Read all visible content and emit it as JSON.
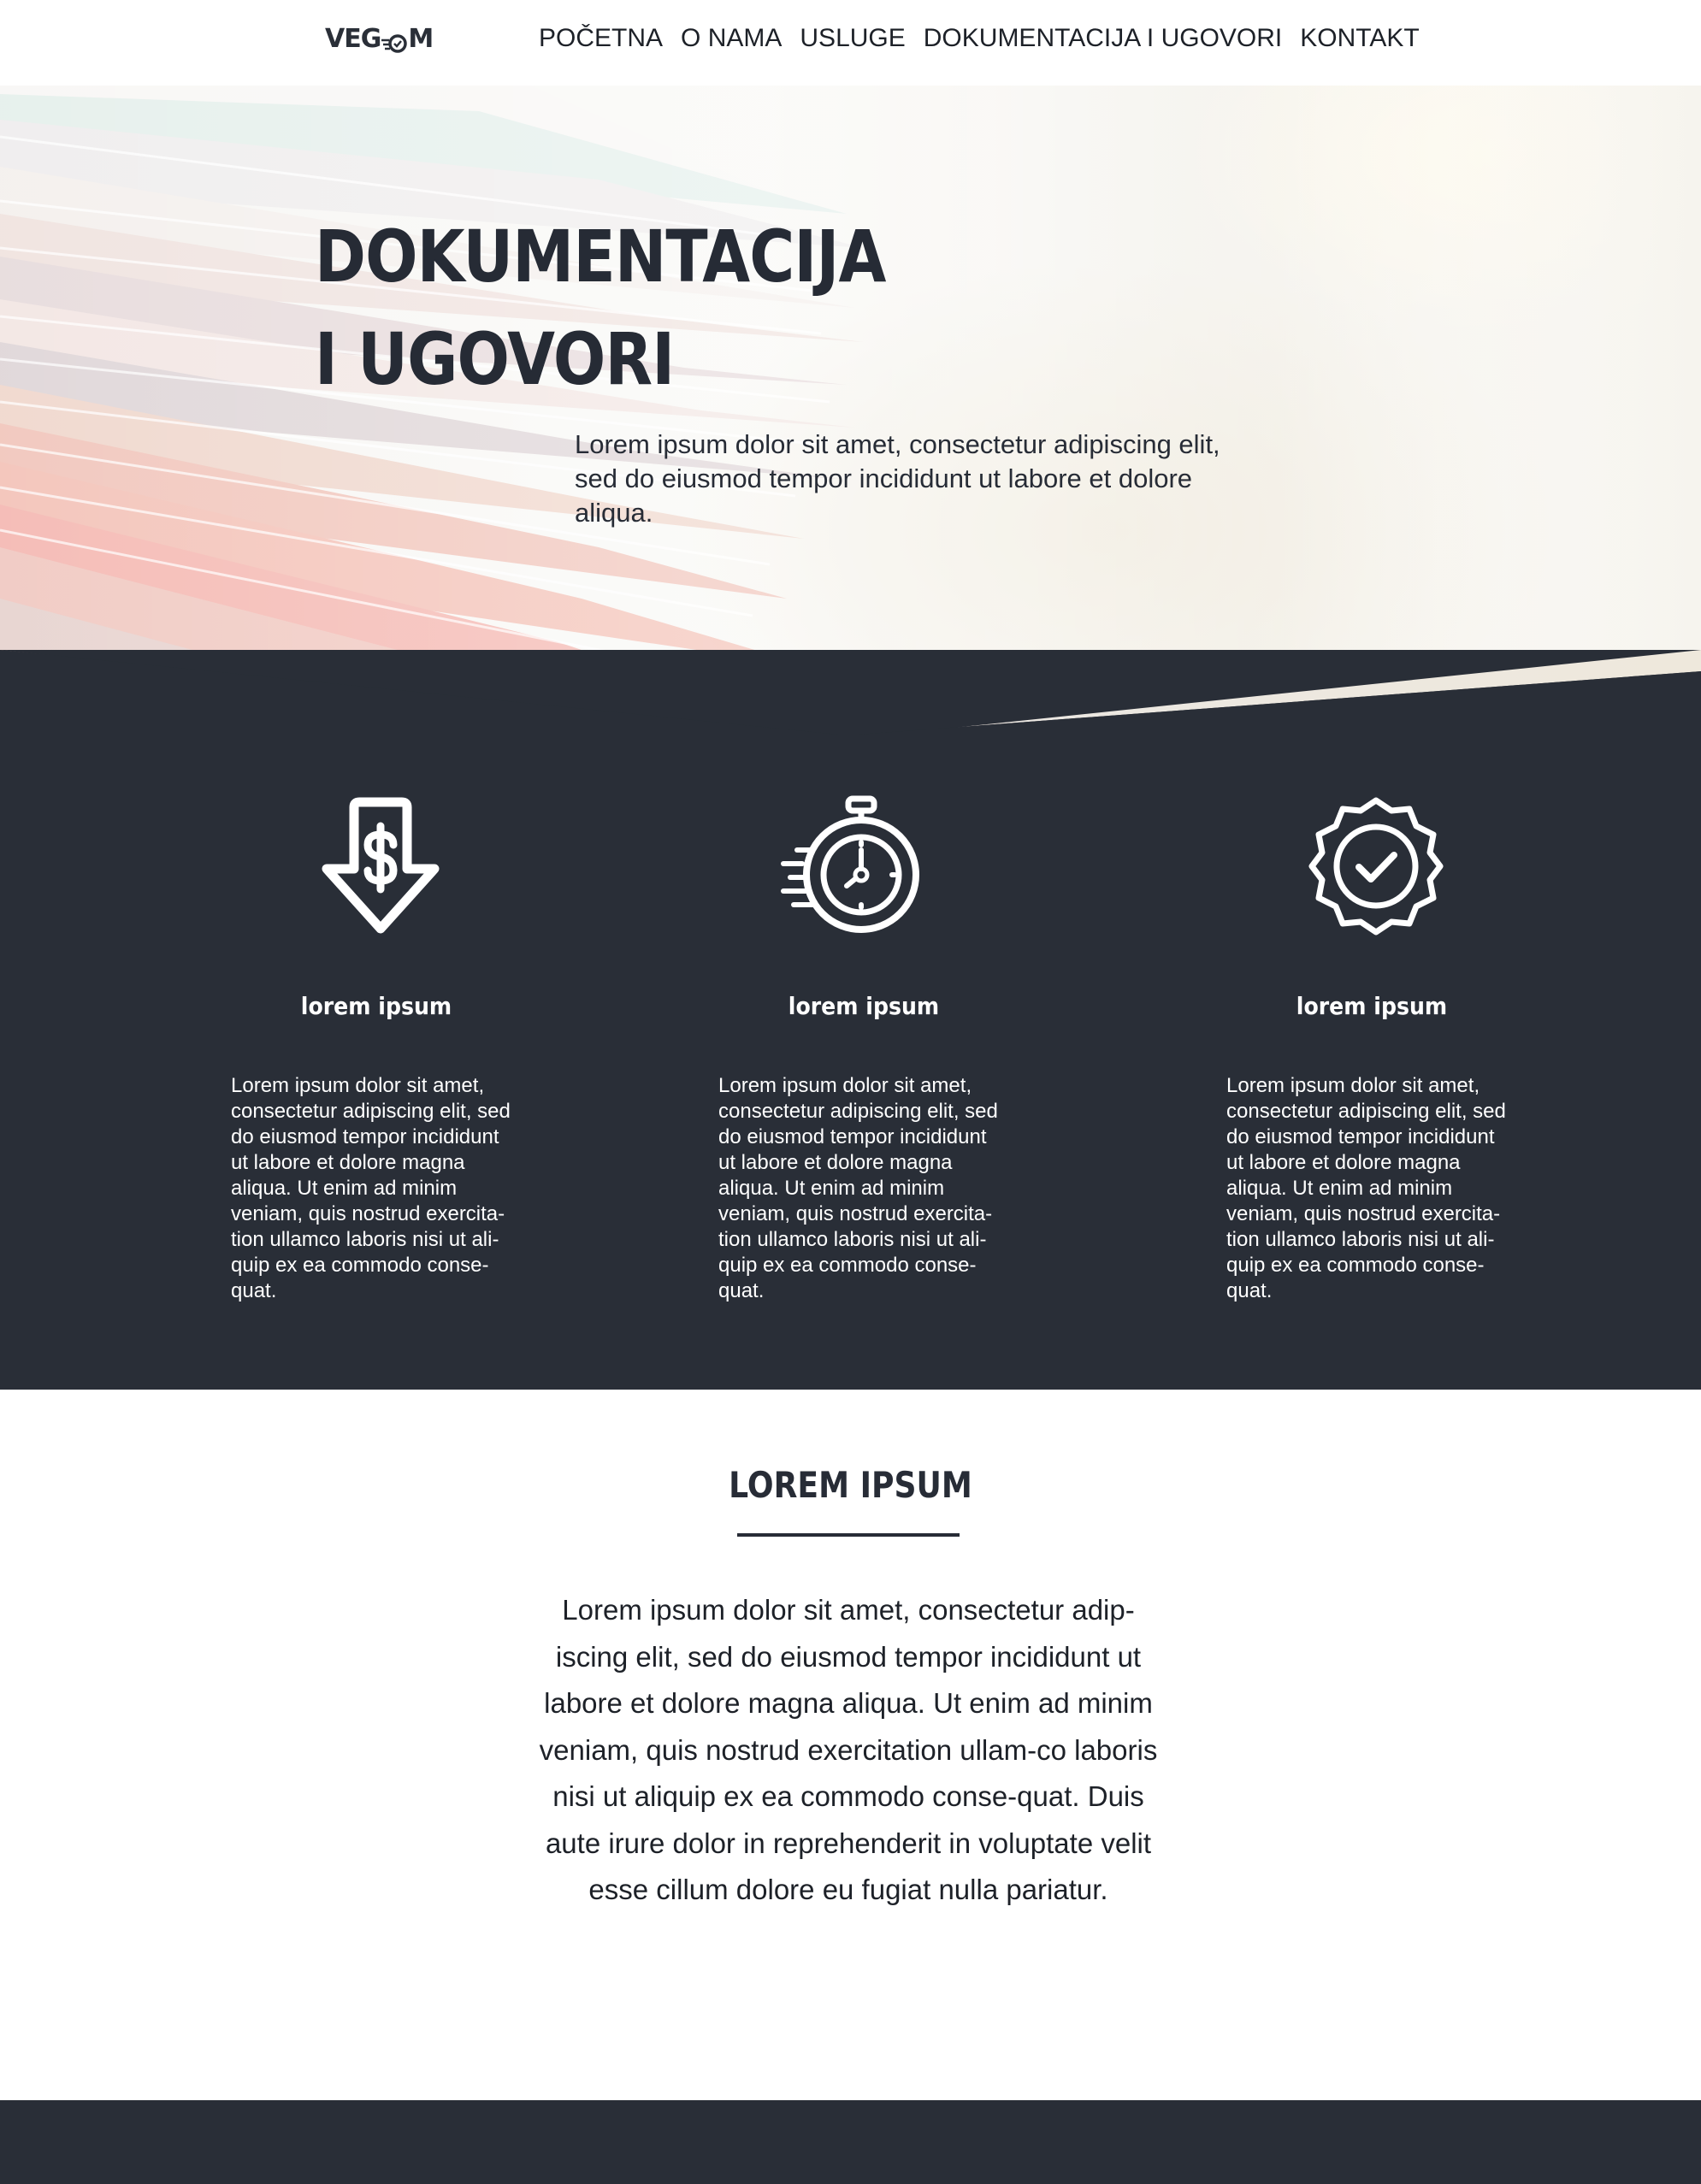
{
  "brand": {
    "logo_text_left": "VEG",
    "logo_text_right": "M"
  },
  "nav": {
    "items": [
      {
        "label": "POČETNA"
      },
      {
        "label": "O NAMA"
      },
      {
        "label": "USLUGE"
      },
      {
        "label": "DOKUMENTACIJA I UGOVORI"
      },
      {
        "label": "KONTAKT"
      }
    ]
  },
  "hero": {
    "title_line1": "DOKUMENTACIJA",
    "title_line2": "I UGOVORI",
    "text": "Lorem ipsum dolor sit amet, consectetur adipiscing elit, sed do eiusmod tempor incididunt ut labore et dolore aliqua."
  },
  "features": [
    {
      "icon": "dollar-down-arrow-icon",
      "title": "lorem ipsum",
      "text": "Lorem ipsum dolor sit amet, consectetur adipiscing elit, sed do eiusmod tempor incididunt ut labore et dolore magna aliqua. Ut enim ad minim veniam, quis nostrud exercita-tion ullamco laboris nisi ut ali-quip ex ea commodo conse-quat."
    },
    {
      "icon": "stopwatch-icon",
      "title": "lorem ipsum",
      "text": "Lorem ipsum dolor sit amet, consectetur adipiscing elit, sed do eiusmod tempor incididunt ut labore et dolore magna aliqua. Ut enim ad minim veniam, quis nostrud exercita-tion ullamco laboris nisi ut ali-quip ex ea commodo conse-quat."
    },
    {
      "icon": "check-badge-icon",
      "title": "lorem ipsum",
      "text": "Lorem ipsum dolor sit amet, consectetur adipiscing elit, sed do eiusmod tempor incididunt ut labore et dolore magna aliqua. Ut enim ad minim veniam, quis nostrud exercita-tion ullamco laboris nisi ut ali-quip ex ea commodo conse-quat."
    }
  ],
  "about": {
    "title": "LOREM IPSUM",
    "text": "Lorem ipsum dolor sit amet, consectetur adip-iscing elit, sed do eiusmod tempor incididunt ut labore et dolore magna aliqua. Ut enim ad minim veniam, quis nostrud exercitation ullam-co laboris nisi ut aliquip ex ea commodo conse-quat. Duis aute irure dolor in reprehenderit in voluptate velit esse cillum dolore eu fugiat nulla pariatur."
  },
  "colors": {
    "dark": "#292e37",
    "text": "#272c36",
    "white": "#ffffff"
  }
}
